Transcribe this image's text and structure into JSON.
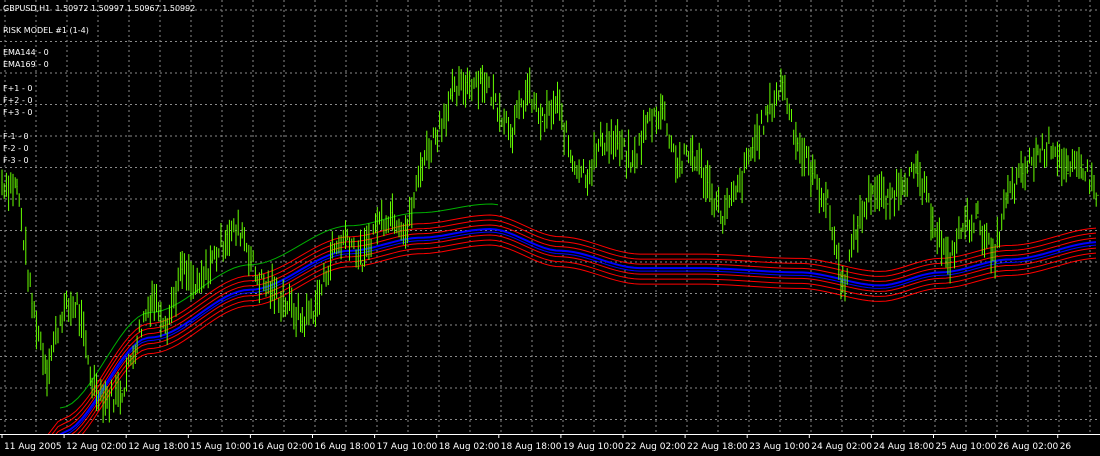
{
  "header": {
    "symbol_tf": "GBPUSD,H1",
    "ohlc": "1.50972 1.50997 1.50967 1.50992"
  },
  "indicator": {
    "title": "RISK MODEL #1 (1-4)",
    "ema144": "EMA144 - 0",
    "ema169": "EMA169 - 0",
    "f_plus": [
      "F+1 - 0",
      "F+2 - 0",
      "F+3 - 0"
    ],
    "f_minus": [
      "F-1 - 0",
      "F-2 - 0",
      "F-3 - 0"
    ]
  },
  "chart_data": {
    "type": "line",
    "grid": true,
    "x_tick_labels": [
      "11 Aug 2005",
      "12 Aug 02:00",
      "12 Aug 18:00",
      "15 Aug 10:00",
      "16 Aug 02:00",
      "16 Aug 18:00",
      "17 Aug 10:00",
      "18 Aug 02:00",
      "18 Aug 18:00",
      "19 Aug 10:00",
      "22 Aug 02:00",
      "22 Aug 18:00",
      "23 Aug 10:00",
      "24 Aug 02:00",
      "24 Aug 18:00",
      "25 Aug 10:00",
      "26 Aug 02:00",
      "26"
    ],
    "colors": {
      "background": "#000000",
      "grid": "#8a8a8a",
      "price": "#66ff00",
      "ema": "#0000ff",
      "fibo_bands": "#ff0000",
      "outer_line": "#00b000",
      "text": "#ffffff"
    },
    "series": [
      {
        "values": [
          [
            0,
            0.58
          ],
          [
            1,
            0.57
          ],
          [
            2,
            0.3
          ],
          [
            3,
            0.15
          ],
          [
            4,
            0.28
          ],
          [
            5,
            0.3
          ],
          [
            6,
            0.12
          ],
          [
            7,
            0.08
          ],
          [
            8,
            0.1
          ],
          [
            9,
            0.22
          ],
          [
            10,
            0.32
          ],
          [
            11,
            0.26
          ],
          [
            12,
            0.38
          ],
          [
            13,
            0.33
          ],
          [
            14,
            0.4
          ],
          [
            15,
            0.46
          ],
          [
            16,
            0.47
          ],
          [
            17,
            0.36
          ],
          [
            18,
            0.33
          ],
          [
            19,
            0.3
          ],
          [
            20,
            0.26
          ],
          [
            21,
            0.3
          ],
          [
            22,
            0.42
          ],
          [
            23,
            0.46
          ],
          [
            24,
            0.4
          ],
          [
            25,
            0.49
          ],
          [
            26,
            0.51
          ],
          [
            27,
            0.47
          ],
          [
            28,
            0.63
          ],
          [
            29,
            0.7
          ],
          [
            30,
            0.78
          ],
          [
            31,
            0.81
          ],
          [
            32,
            0.82
          ],
          [
            33,
            0.76
          ],
          [
            34,
            0.7
          ],
          [
            35,
            0.79
          ],
          [
            36,
            0.72
          ],
          [
            37,
            0.76
          ],
          [
            38,
            0.63
          ],
          [
            39,
            0.6
          ],
          [
            40,
            0.68
          ],
          [
            41,
            0.67
          ],
          [
            42,
            0.62
          ],
          [
            43,
            0.72
          ],
          [
            44,
            0.75
          ],
          [
            45,
            0.62
          ],
          [
            46,
            0.65
          ],
          [
            47,
            0.58
          ],
          [
            48,
            0.5
          ],
          [
            49,
            0.56
          ],
          [
            50,
            0.66
          ],
          [
            51,
            0.74
          ],
          [
            52,
            0.81
          ],
          [
            53,
            0.67
          ],
          [
            54,
            0.6
          ],
          [
            55,
            0.53
          ],
          [
            56,
            0.34
          ],
          [
            57,
            0.48
          ],
          [
            58,
            0.57
          ],
          [
            59,
            0.53
          ],
          [
            60,
            0.59
          ],
          [
            61,
            0.6
          ],
          [
            62,
            0.5
          ],
          [
            63,
            0.39
          ],
          [
            64,
            0.48
          ],
          [
            65,
            0.5
          ],
          [
            66,
            0.4
          ],
          [
            67,
            0.55
          ],
          [
            68,
            0.6
          ],
          [
            69,
            0.65
          ],
          [
            70,
            0.67
          ],
          [
            71,
            0.6
          ],
          [
            72,
            0.62
          ],
          [
            73,
            0.55
          ]
        ]
      }
    ]
  }
}
